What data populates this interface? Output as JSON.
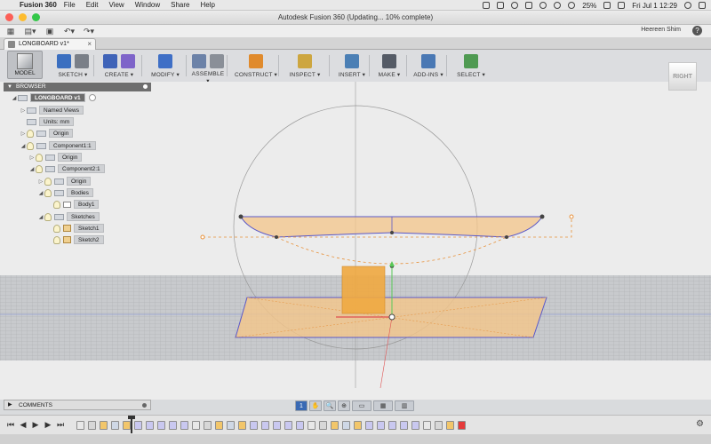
{
  "os_menu": {
    "app_name": "Fusion 360",
    "items": [
      "File",
      "Edit",
      "View",
      "Window",
      "Share",
      "Help"
    ],
    "battery": "25%",
    "datetime": "Fri Jul 1  12:29"
  },
  "window": {
    "title": "Autodesk Fusion 360  (Updating... 10% complete)",
    "traffic_colors": [
      "#fc5f57",
      "#fdbc2e",
      "#33c748"
    ]
  },
  "quick_access": {
    "user": "Heereen Shim"
  },
  "tab": {
    "title": "LONGBOARD v1*"
  },
  "toolbar": {
    "workspace": "MODEL",
    "groups": [
      {
        "label": "SKETCH",
        "colors": [
          "#3b6fc0",
          "#7a7f88"
        ]
      },
      {
        "label": "CREATE",
        "colors": [
          "#3f63b8",
          "#7e64c9"
        ]
      },
      {
        "label": "MODIFY",
        "colors": [
          "#3f6fc6"
        ]
      },
      {
        "label": "ASSEMBLE",
        "colors": [
          "#6c82a8",
          "#8a8f98"
        ]
      },
      {
        "label": "CONSTRUCT",
        "colors": [
          "#e08a2c"
        ]
      },
      {
        "label": "INSPECT",
        "colors": [
          "#cda640"
        ]
      },
      {
        "label": "INSERT",
        "colors": [
          "#4b7fb5"
        ]
      },
      {
        "label": "MAKE",
        "colors": [
          "#555b66"
        ]
      },
      {
        "label": "ADD-INS",
        "colors": [
          "#4a78b4"
        ]
      },
      {
        "label": "SELECT",
        "colors": [
          "#4f9a52"
        ]
      }
    ]
  },
  "browser": {
    "title": "BROWSER",
    "nodes": [
      {
        "label": "LONGBOARD v1",
        "level": 0,
        "icon": "doc-icon"
      },
      {
        "label": "Named Views",
        "level": 1,
        "icon": "folder-icon"
      },
      {
        "label": "Units: mm",
        "level": 1,
        "icon": "doc-icon"
      },
      {
        "label": "Origin",
        "level": 1,
        "icon": "folder-icon"
      },
      {
        "label": "Component1:1",
        "level": 1,
        "icon": "component-icon"
      },
      {
        "label": "Origin",
        "level": 2,
        "icon": "folder-icon"
      },
      {
        "label": "Component2:1",
        "level": 2,
        "icon": "component-icon"
      },
      {
        "label": "Origin",
        "level": 3,
        "icon": "folder-icon"
      },
      {
        "label": "Bodies",
        "level": 3,
        "icon": "folder-icon"
      },
      {
        "label": "Body1",
        "level": 4,
        "icon": "body-icon"
      },
      {
        "label": "Sketches",
        "level": 3,
        "icon": "folder-icon"
      },
      {
        "label": "Sketch1",
        "level": 4,
        "icon": "sketch-icon"
      },
      {
        "label": "Sketch2",
        "level": 4,
        "icon": "sketch-icon"
      }
    ]
  },
  "viewcube": {
    "face": "RIGHT"
  },
  "comments": {
    "title": "COMMENTS"
  },
  "navbar": {
    "items": [
      "1",
      "✋",
      "🔍",
      "⊕",
      "▭",
      "▦",
      "▥"
    ]
  },
  "colors": {
    "sketch_fill": "#f4c58a",
    "sketch_line": "#5a58c8",
    "dashed": "#e8913a",
    "y_axis": "#58c858",
    "x_axis": "#e05050",
    "body_fill": "#f0a840",
    "timeline_red": "#e53b3b"
  }
}
